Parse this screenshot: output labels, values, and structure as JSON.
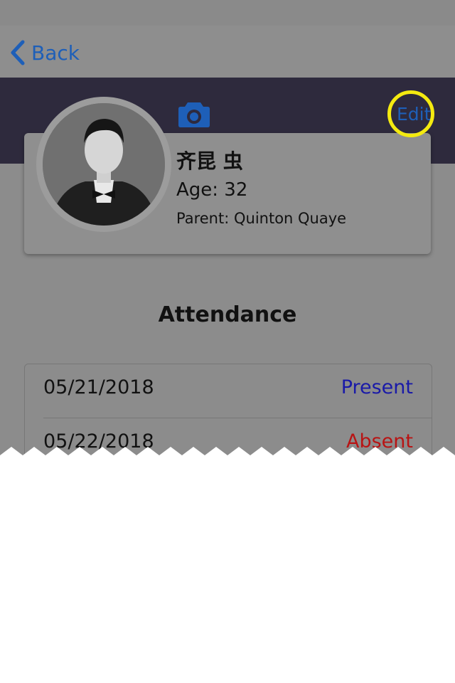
{
  "nav": {
    "back_label": "Back",
    "edit_label": "Edit"
  },
  "profile": {
    "name": "齐昆 虫",
    "age": "Age: 32",
    "parent": "Parent: Quinton Quaye"
  },
  "attendance": {
    "title": "Attendance",
    "rows": [
      {
        "date": "05/21/2018",
        "status": "Present",
        "status_color": "#1a1aa8"
      },
      {
        "date": "05/22/2018",
        "status": "Absent",
        "status_color": "#b81414"
      }
    ]
  },
  "colors": {
    "accent": "#1e5fb8",
    "header": "#2e2a3d",
    "highlight": "#f4ea10"
  },
  "icons": {
    "back": "chevron-left-icon",
    "camera": "camera-icon"
  }
}
